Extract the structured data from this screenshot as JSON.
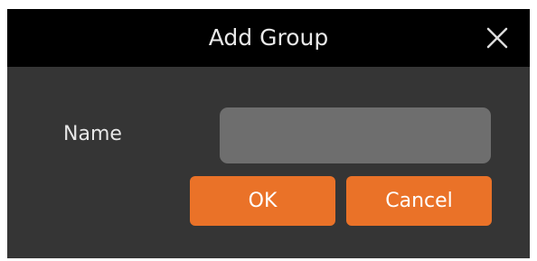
{
  "dialog": {
    "title": "Add Group",
    "close_icon": "close-icon",
    "name_label": "Name",
    "name_value": "",
    "name_placeholder": "",
    "ok_label": "OK",
    "cancel_label": "Cancel"
  },
  "colors": {
    "titlebar": "#000000",
    "body": "#353535",
    "input": "#6e6e6e",
    "accent": "#ea7228",
    "text": "#e9e9e9"
  }
}
